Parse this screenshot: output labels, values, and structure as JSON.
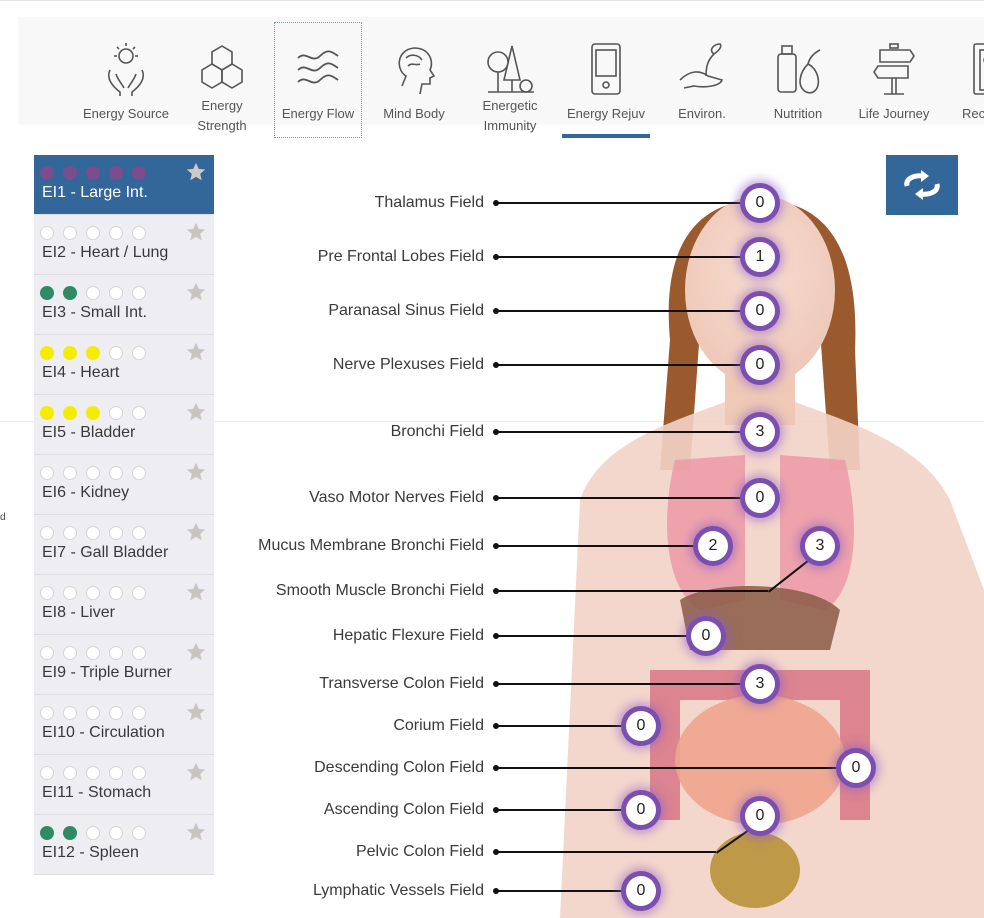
{
  "tabs": [
    {
      "label": "Energy Source",
      "icon": "hands-sun-icon"
    },
    {
      "label": "Energy Strength",
      "icon": "hexagons-icon"
    },
    {
      "label": "Energy Flow",
      "icon": "waves-icon",
      "focused": true
    },
    {
      "label": "Mind Body",
      "icon": "brain-head-icon"
    },
    {
      "label": "Energetic Immunity",
      "icon": "trees-icon"
    },
    {
      "label": "Energy Rejuv",
      "icon": "device-icon",
      "selected": true
    },
    {
      "label": "Environ.",
      "icon": "plant-hand-icon"
    },
    {
      "label": "Nutrition",
      "icon": "bottle-pear-icon"
    },
    {
      "label": "Life Journey",
      "icon": "signpost-icon"
    },
    {
      "label": "Rec",
      "icon": "document-icon"
    }
  ],
  "tab_lines": {
    "energy_strength": [
      "Energy",
      "Strength"
    ],
    "energetic_immunity": [
      "Energetic",
      "Immunity"
    ]
  },
  "colors": {
    "accent": "#336699",
    "purple": "#7b4d8c",
    "green": "#2e8b65",
    "yellow": "#f5ec00",
    "empty": "#ffffff"
  },
  "sidebar": {
    "items": [
      {
        "name": "EI1 - Large Int.",
        "dots": [
          "purple",
          "purple",
          "purple",
          "purple",
          "purple"
        ],
        "active": true
      },
      {
        "name": "EI2 - Heart / Lung",
        "dots": [
          "empty",
          "empty",
          "empty",
          "empty",
          "empty"
        ]
      },
      {
        "name": "EI3 - Small Int.",
        "dots": [
          "green",
          "green",
          "empty",
          "empty",
          "empty"
        ]
      },
      {
        "name": "EI4 - Heart",
        "dots": [
          "yellow",
          "yellow",
          "yellow",
          "empty",
          "empty"
        ]
      },
      {
        "name": "EI5 - Bladder",
        "dots": [
          "yellow",
          "yellow",
          "yellow",
          "empty",
          "empty"
        ]
      },
      {
        "name": "EI6 - Kidney",
        "dots": [
          "empty",
          "empty",
          "empty",
          "empty",
          "empty"
        ]
      },
      {
        "name": "EI7 - Gall Bladder",
        "dots": [
          "empty",
          "empty",
          "empty",
          "empty",
          "empty"
        ]
      },
      {
        "name": "EI8 - Liver",
        "dots": [
          "empty",
          "empty",
          "empty",
          "empty",
          "empty"
        ]
      },
      {
        "name": "EI9 - Triple Burner",
        "dots": [
          "empty",
          "empty",
          "empty",
          "empty",
          "empty"
        ]
      },
      {
        "name": "EI10 - Circulation",
        "dots": [
          "empty",
          "empty",
          "empty",
          "empty",
          "empty"
        ]
      },
      {
        "name": "EI11 - Stomach",
        "dots": [
          "empty",
          "empty",
          "empty",
          "empty",
          "empty"
        ]
      },
      {
        "name": "EI12 - Spleen",
        "dots": [
          "green",
          "green",
          "empty",
          "empty",
          "empty"
        ]
      }
    ]
  },
  "refresh_button": {
    "icon": "refresh-icon"
  },
  "fields": [
    {
      "label": "Thalamus Field",
      "value": "0"
    },
    {
      "label": "Pre Frontal Lobes Field",
      "value": "1"
    },
    {
      "label": "Paranasal Sinus Field",
      "value": "0"
    },
    {
      "label": "Nerve Plexuses Field",
      "value": "0"
    },
    {
      "label": "Bronchi Field",
      "value": "3"
    },
    {
      "label": "Vaso Motor Nerves Field",
      "value": "0"
    },
    {
      "label": "Mucus Membrane Bronchi Field",
      "value": "2"
    },
    {
      "label": "Smooth Muscle Bronchi Field",
      "value": "3"
    },
    {
      "label": "Hepatic Flexure Field",
      "value": "0"
    },
    {
      "label": "Transverse Colon Field",
      "value": "3"
    },
    {
      "label": "Corium Field",
      "value": "0"
    },
    {
      "label": "Descending Colon Field",
      "value": "0"
    },
    {
      "label": "Ascending Colon Field",
      "value": "0"
    },
    {
      "label": "Pelvic Colon Field",
      "value": "0"
    },
    {
      "label": "Lymphatic Vessels Field",
      "value": "0"
    }
  ],
  "cut_text": "d"
}
